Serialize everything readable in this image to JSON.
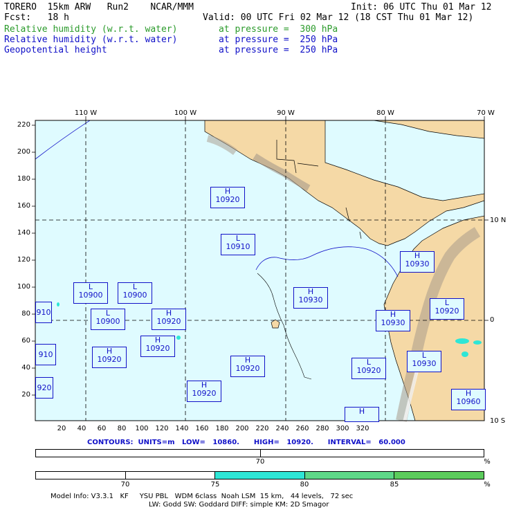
{
  "header": {
    "title_line": "TORERO  15km ARW   Run2    NCAR/MMM",
    "init": "Init: 06 UTC Thu 01 Mar 12",
    "fcst": "Fcst:   18 h",
    "valid": "Valid: 00 UTC Fri 02 Mar 12 (18 CST Thu 01 Mar 12)",
    "fields": [
      {
        "name": "Relative humidity (w.r.t. water)",
        "level": "at pressure =  300 hPa",
        "color": "#2a9a2a"
      },
      {
        "name": "Relative humidity (w.r.t. water)",
        "level": "at pressure =  250 hPa",
        "color": "#1010c8"
      },
      {
        "name": "Geopotential height",
        "level": "at pressure =  250 hPa",
        "color": "#1010c8"
      }
    ]
  },
  "map": {
    "ocean_color": "#dffbff",
    "land_color": "#f5d9a6",
    "y_ticks": [
      "220",
      "200",
      "180",
      "160",
      "140",
      "120",
      "100",
      "80",
      "60",
      "40",
      "20"
    ],
    "x_ticks": [
      "20",
      "40",
      "60",
      "80",
      "100",
      "120",
      "140",
      "160",
      "180",
      "200",
      "220",
      "240",
      "260",
      "280",
      "300",
      "320"
    ],
    "lon_labels": [
      "110 W",
      "100 W",
      "90 W",
      "80 W",
      "70 W"
    ],
    "lat_labels": [
      "10 N",
      "0",
      "10 S"
    ],
    "centers": [
      {
        "type": "H",
        "value": "10920"
      },
      {
        "type": "L",
        "value": "10910"
      },
      {
        "type": "H",
        "value": "10930"
      },
      {
        "type": "L",
        "value": "10900"
      },
      {
        "type": "L",
        "value": "10900"
      },
      {
        "type": "L",
        "value": "10900"
      },
      {
        "type": "H",
        "value": "10920"
      },
      {
        "type": "H",
        "value": "10930"
      },
      {
        "type": "H",
        "value": "10930"
      },
      {
        "type": "L",
        "value": "10920"
      },
      {
        "type": "H",
        "value": "10920"
      },
      {
        "type": "H",
        "value": "10920"
      },
      {
        "type": "H",
        "value": "10920"
      },
      {
        "type": "H",
        "value": "10920"
      },
      {
        "type": "L",
        "value": "10920"
      },
      {
        "type": "L",
        "value": "10930"
      },
      {
        "type": "H",
        "value": "10960"
      },
      {
        "type": "H",
        "value": ""
      },
      {
        "type": "",
        "value": "910"
      },
      {
        "type": "",
        "value": "910"
      },
      {
        "type": "",
        "value": "920"
      }
    ]
  },
  "contours": "CONTOURS:  UNITS=m   LOW=   10860.      HIGH=   10920.      INTERVAL=   60.000",
  "scales": [
    {
      "ticks": [
        "70"
      ],
      "unit": "%",
      "segments": []
    },
    {
      "ticks": [
        "70",
        "75",
        "80",
        "85"
      ],
      "unit": "%",
      "segments": [
        "#ffffff",
        "#ffffff",
        "#2ee6d6",
        "#5ed888",
        "#5ccc5c"
      ]
    }
  ],
  "footer": {
    "line1": "Model Info: V3.3.1   KF     YSU PBL   WDM 6class  Noah LSM  15 km,   44 levels,   72 sec",
    "line2": "LW: Godd SW: Goddard DIFF: simple KM: 2D Smagor"
  }
}
